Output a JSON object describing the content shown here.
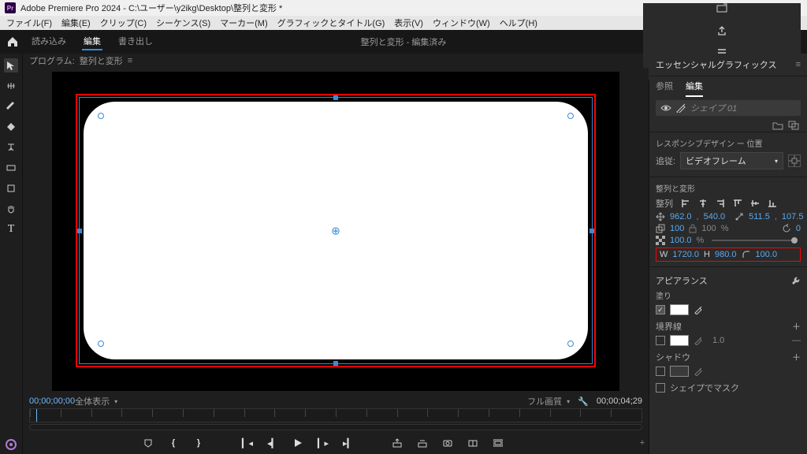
{
  "window": {
    "title": "Adobe Premiere Pro 2024 - C:\\ユーザー\\y2ikg\\Desktop\\整列と変形 *"
  },
  "menu": {
    "file": "ファイル(F)",
    "edit": "編集(E)",
    "clip": "クリップ(C)",
    "sequence": "シーケンス(S)",
    "marker": "マーカー(M)",
    "graphics": "グラフィックとタイトル(G)",
    "view": "表示(V)",
    "window": "ウィンドウ(W)",
    "help": "ヘルプ(H)"
  },
  "workspace": {
    "import": "読み込み",
    "edit": "編集",
    "export": "書き出し",
    "center": "整列と変形 - 編集済み"
  },
  "program": {
    "label": "プログラム:",
    "seq_name": "整列と変形",
    "tc_left": "00;00;00;00",
    "zoom": "全体表示",
    "fit": "フル画質",
    "tc_right": "00;00;04;29"
  },
  "eg": {
    "title": "エッセンシャルグラフィックス",
    "tab_browse": "参照",
    "tab_edit": "編集",
    "layer_name": "シェイプ 01",
    "responsive_label": "レスポンシブデザイン ー 位置",
    "follow_label": "追従:",
    "follow_value": "ビデオフレーム",
    "align_section": "整列と変形",
    "align_label": "整列",
    "pos_x": "962.0",
    "pos_sep": ",",
    "pos_y": "540.0",
    "anchor_x": "511.5",
    "anchor_sep": ",",
    "anchor_y": "107.5",
    "scale_w": "100",
    "scale_h": "100",
    "pct": "%",
    "rot": "0",
    "opacity": "100.0",
    "opacity_pct": "%",
    "W_label": "W",
    "W": "1720.0",
    "H_label": "H",
    "H": "980.0",
    "R": "100.0",
    "appearance": "アピアランス",
    "fill_label": "塗り",
    "stroke_label": "境界線",
    "stroke_w": "1.0",
    "shadow_label": "シャドウ",
    "mask_label": "シェイプでマスク"
  }
}
